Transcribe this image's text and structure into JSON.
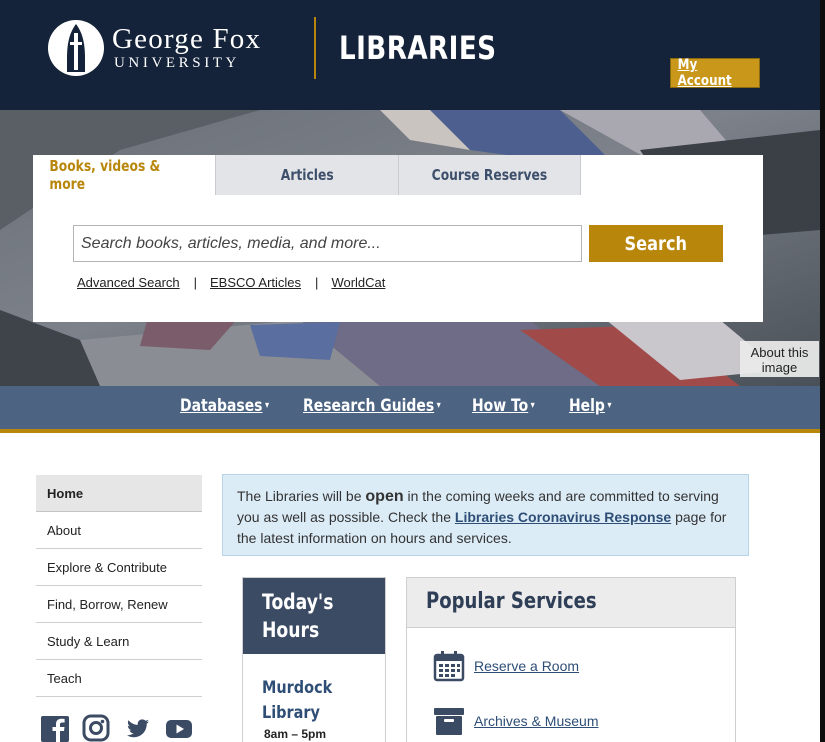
{
  "header": {
    "university_name": "George Fox",
    "university_sub": "UNIVERSITY",
    "site_title": "LIBRARIES",
    "account_label": "My Account"
  },
  "search": {
    "tabs": [
      {
        "label": "Books, videos & more",
        "active": true
      },
      {
        "label": "Articles",
        "active": false
      },
      {
        "label": "Course Reserves",
        "active": false
      }
    ],
    "placeholder": "Search books, articles, media, and more...",
    "value": "",
    "button_label": "Search",
    "links": [
      "Advanced Search",
      "EBSCO Articles",
      "WorldCat"
    ],
    "separator": "|"
  },
  "hero": {
    "about_image": "About this image"
  },
  "nav": {
    "items": [
      {
        "label": "Databases"
      },
      {
        "label": "Research Guides"
      },
      {
        "label": "How To"
      },
      {
        "label": "Help"
      }
    ],
    "caret": "▾"
  },
  "sidebar": {
    "items": [
      {
        "label": "Home",
        "active": true
      },
      {
        "label": "About"
      },
      {
        "label": "Explore & Contribute"
      },
      {
        "label": "Find, Borrow, Renew"
      },
      {
        "label": "Study & Learn"
      },
      {
        "label": "Teach"
      }
    ],
    "social_icons": [
      "facebook-icon",
      "instagram-icon",
      "twitter-icon",
      "youtube-icon"
    ]
  },
  "notice": {
    "part1": "The Libraries will be ",
    "open_word": "open",
    "part2": " in the coming weeks and are committed to serving you as well as possible.  Check the ",
    "link_text": "Libraries Coronavirus Response",
    "part3": " page for the latest information on hours and services."
  },
  "hours": {
    "title": "Today's Hours",
    "location": "Murdock Library",
    "time": "8am – 5pm"
  },
  "popular": {
    "title": "Popular Services",
    "items": [
      {
        "label": "Reserve a Room",
        "icon": "calendar-icon"
      },
      {
        "label": "Archives & Museum",
        "icon": "archive-box-icon"
      }
    ]
  },
  "colors": {
    "header_bg": "#142339",
    "gold": "#b8860b",
    "nav_bg": "#4c6482",
    "link_blue": "#2e4e76",
    "notice_bg": "#dcecf7"
  }
}
